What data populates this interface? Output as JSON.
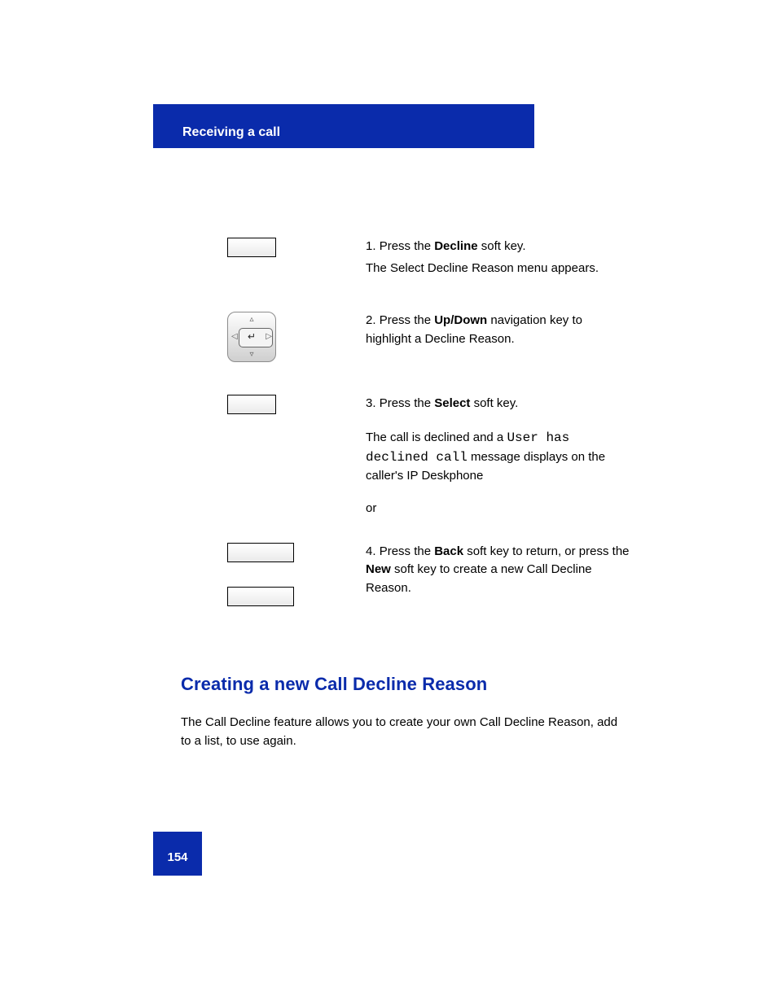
{
  "header": {
    "running_title": "Receiving a call"
  },
  "steps": {
    "s1": {
      "num": "1.",
      "text_a": "Press the ",
      "key": "Decline",
      "text_b": " soft key.",
      "line2": "The Select Decline Reason menu appears."
    },
    "s2": {
      "num": "2.",
      "text_a": "Press the ",
      "keys": "Up/Down",
      "text_b": " navigation key to highlight a Decline Reason."
    },
    "s3": {
      "num": "3.",
      "text_a": "Press the ",
      "key": "Select",
      "text_b": " soft key.",
      "result_a": "The call is declined and a ",
      "mono": "User has declined call",
      "result_b": " message displays on the caller's IP Deskphone"
    },
    "s4": {
      "orNum": "or",
      "num": "4.",
      "text_a": "Press the ",
      "key_back": "Back",
      "text_btwn": " soft key to return, or press the ",
      "key_new": "New",
      "text_end": " soft key to create a new Call Decline Reason."
    }
  },
  "heading": "Creating a new Call Decline Reason",
  "section_para": "The Call Decline feature allows you to create your own Call Decline Reason, add to a list, to use again.",
  "page_number": "154"
}
